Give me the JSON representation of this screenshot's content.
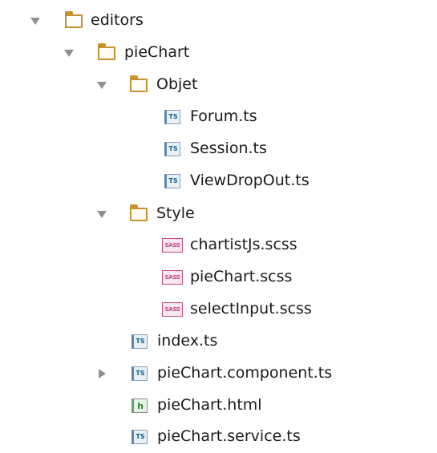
{
  "tree": {
    "editors": {
      "label": "editors",
      "expanded": true,
      "icon": "folder-icon"
    },
    "pieChart": {
      "label": "pieChart",
      "expanded": true,
      "icon": "folder-icon"
    },
    "objet": {
      "label": "Objet",
      "expanded": true,
      "icon": "folder-icon"
    },
    "forum": {
      "label": "Forum.ts",
      "icon": "typescript-file-icon",
      "badge": "TS"
    },
    "session": {
      "label": "Session.ts",
      "icon": "typescript-file-icon",
      "badge": "TS"
    },
    "viewDropOut": {
      "label": "ViewDropOut.ts",
      "icon": "typescript-file-icon",
      "badge": "TS"
    },
    "style": {
      "label": "Style",
      "expanded": true,
      "icon": "folder-icon"
    },
    "chartistJs": {
      "label": "chartistJs.scss",
      "icon": "sass-file-icon",
      "badge": "SASS"
    },
    "pieChartScss": {
      "label": "pieChart.scss",
      "icon": "sass-file-icon",
      "badge": "SASS"
    },
    "selectInput": {
      "label": "selectInput.scss",
      "icon": "sass-file-icon",
      "badge": "SASS"
    },
    "index": {
      "label": "index.ts",
      "icon": "typescript-file-icon",
      "badge": "TS"
    },
    "pieChartComponent": {
      "label": "pieChart.component.ts",
      "expanded": false,
      "icon": "typescript-file-icon",
      "badge": "TS"
    },
    "pieChartHtml": {
      "label": "pieChart.html",
      "icon": "html-file-icon",
      "badge": "h"
    },
    "pieChartService": {
      "label": "pieChart.service.ts",
      "icon": "typescript-file-icon",
      "badge": "TS"
    }
  },
  "colors": {
    "folder": "#c9922e",
    "ts": "#1e5a8c",
    "sass": "#c7457f",
    "html": "#2f8a2f",
    "arrow": "#909090"
  }
}
